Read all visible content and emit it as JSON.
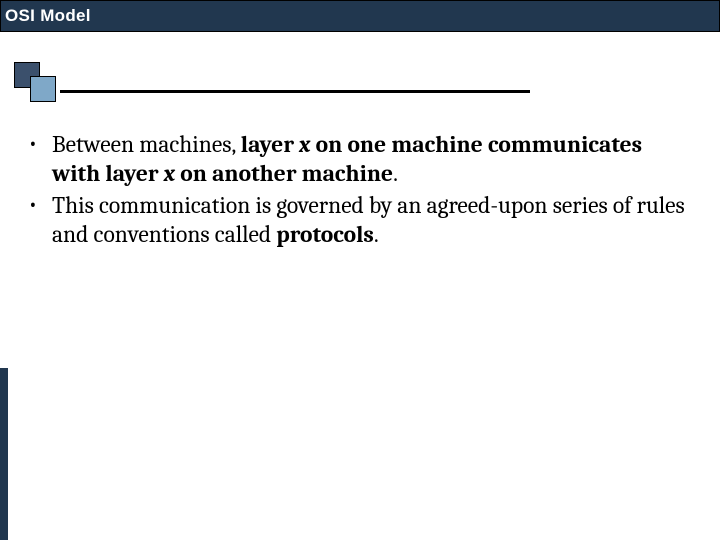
{
  "title": "OSI Model",
  "bullets": [
    {
      "runs": [
        {
          "t": "Between machines, ",
          "cls": ""
        },
        {
          "t": "layer ",
          "cls": "b"
        },
        {
          "t": "x",
          "cls": "bi"
        },
        {
          "t": " on one machine communicates with layer ",
          "cls": "b"
        },
        {
          "t": "x",
          "cls": "bi"
        },
        {
          "t": " on another machine",
          "cls": "b"
        },
        {
          "t": ".",
          "cls": ""
        }
      ]
    },
    {
      "runs": [
        {
          "t": "This communication is governed by an agreed-upon series of rules and conventions called ",
          "cls": ""
        },
        {
          "t": "protocols",
          "cls": "b"
        },
        {
          "t": ".",
          "cls": ""
        }
      ]
    }
  ]
}
